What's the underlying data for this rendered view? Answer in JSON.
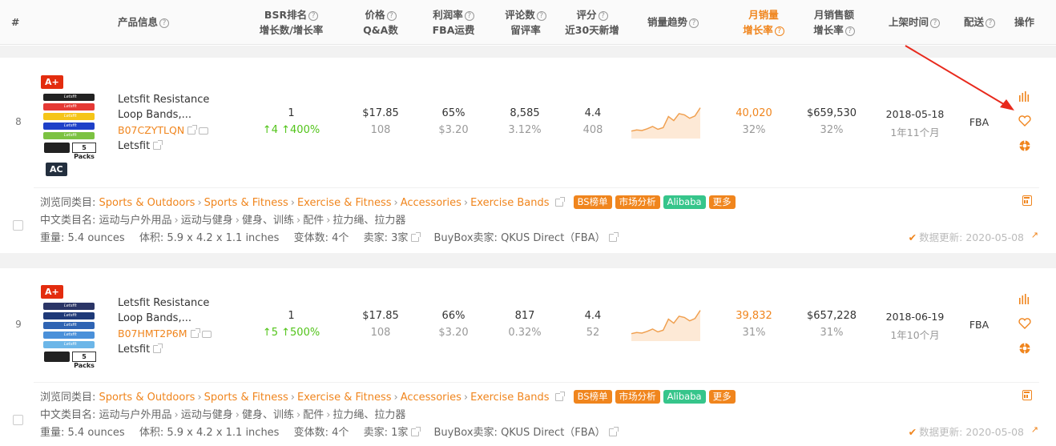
{
  "header": {
    "index": "#",
    "product_info": "产品信息",
    "bsr_rank": "BSR排名",
    "bsr_growth": "增长数/增长率",
    "price": "价格",
    "qa": "Q&A数",
    "profit": "利润率",
    "fba_fee": "FBA运费",
    "reviews": "评论数",
    "review_rate": "留评率",
    "rating": "评分",
    "new_30d": "近30天新增",
    "sales_trend": "销量趋势",
    "monthly_sales": "月销量",
    "monthly_sales_growth": "增长率",
    "monthly_revenue": "月销售额",
    "revenue_growth": "增长率",
    "listing_date": "上架时间",
    "fulfillment": "配送",
    "actions": "操作"
  },
  "labels": {
    "category_browse": "浏览同类目:",
    "category_cn": "中文类目名:",
    "weight_label": "重量:",
    "volume_label": "体积:",
    "variants_label": "变体数:",
    "sellers_label": "卖家:",
    "buybox_label": "BuyBox卖家:",
    "update_label": "数据更新:",
    "tag_bs": "BS榜单",
    "tag_market": "市场分析",
    "tag_alibaba": "Alibaba",
    "tag_more": "更多",
    "badge_aplus": "A+",
    "badge_ac": "AC",
    "pack_label": "5 Packs"
  },
  "products": [
    {
      "index": "8",
      "title_line1": "Letsfit Resistance",
      "title_line2": "Loop Bands,...",
      "asin": "B07CZYTLQN",
      "brand": "Letsfit",
      "bsr": "1",
      "bsr_growth_num": "4",
      "bsr_growth_pct": "400%",
      "price": "$17.85",
      "qa": "108",
      "profit": "65%",
      "fba_fee": "$3.20",
      "reviews": "8,585",
      "review_rate": "3.12%",
      "rating": "4.4",
      "new_30d": "408",
      "monthly_sales": "40,020",
      "sales_growth": "32%",
      "monthly_revenue": "$659,530",
      "revenue_growth": "32%",
      "listing_date": "2018-05-18",
      "listing_age": "1年11个月",
      "fulfillment": "FBA",
      "has_ac": true,
      "band_colors": [
        "#222222",
        "#e53935",
        "#f5c518",
        "#1e40c8",
        "#7cc242"
      ],
      "trend": [
        30,
        32,
        31,
        34,
        38,
        33,
        36,
        55,
        48,
        60,
        58,
        52,
        56,
        70
      ],
      "categories": [
        "Sports & Outdoors",
        "Sports & Fitness",
        "Exercise & Fitness",
        "Accessories",
        "Exercise Bands"
      ],
      "categories_cn": [
        "运动与户外用品",
        "运动与健身",
        "健身、训练",
        "配件",
        "拉力绳、拉力器"
      ],
      "weight": "5.4 ounces",
      "volume": "5.9 x 4.2 x 1.1 inches",
      "variants": "4个",
      "sellers": "3家",
      "buybox": "QKUS Direct（FBA）",
      "update_date": "2020-05-08"
    },
    {
      "index": "9",
      "title_line1": "Letsfit Resistance",
      "title_line2": "Loop Bands,...",
      "asin": "B07HMT2P6M",
      "brand": "Letsfit",
      "bsr": "1",
      "bsr_growth_num": "5",
      "bsr_growth_pct": "500%",
      "price": "$17.85",
      "qa": "108",
      "profit": "66%",
      "fba_fee": "$3.20",
      "reviews": "817",
      "review_rate": "0.32%",
      "rating": "4.4",
      "new_30d": "52",
      "monthly_sales": "39,832",
      "sales_growth": "31%",
      "monthly_revenue": "$657,228",
      "revenue_growth": "31%",
      "listing_date": "2018-06-19",
      "listing_age": "1年10个月",
      "fulfillment": "FBA",
      "has_ac": false,
      "band_colors": [
        "#2b3566",
        "#1f3a78",
        "#2f64b3",
        "#4a90d9",
        "#6cb6e8"
      ],
      "trend": [
        30,
        32,
        31,
        34,
        38,
        33,
        36,
        55,
        48,
        60,
        58,
        52,
        56,
        70
      ],
      "categories": [
        "Sports & Outdoors",
        "Sports & Fitness",
        "Exercise & Fitness",
        "Accessories",
        "Exercise Bands"
      ],
      "categories_cn": [
        "运动与户外用品",
        "运动与健身",
        "健身、训练",
        "配件",
        "拉力绳、拉力器"
      ],
      "weight": "5.4 ounces",
      "volume": "5.9 x 4.2 x 1.1 inches",
      "variants": "4个",
      "sellers": "1家",
      "buybox": "QKUS Direct（FBA）",
      "update_date": "2020-05-08"
    }
  ],
  "colors": {
    "accent": "#f0851d",
    "green": "#52c41a",
    "tag_green": "#36c58b",
    "badge_red": "#e32c0e",
    "annotation_arrow": "#e8291c"
  }
}
